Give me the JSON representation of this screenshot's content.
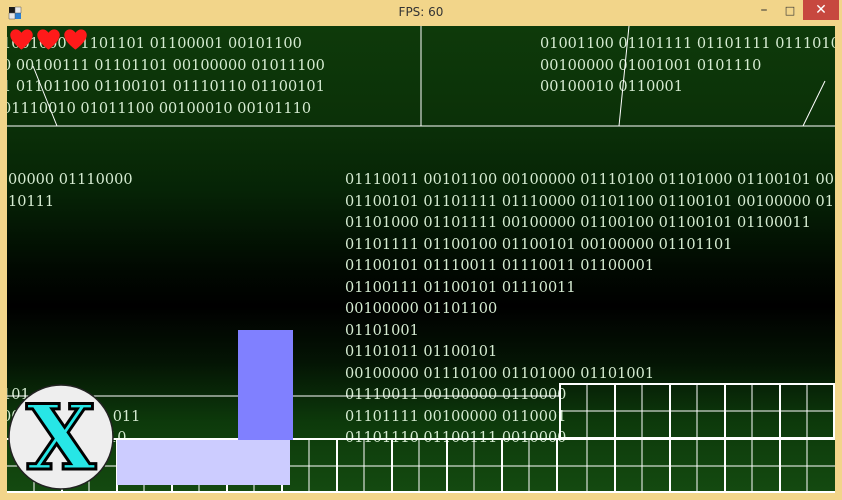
{
  "window": {
    "title": "FPS: 60",
    "controls": {
      "minimize": "–",
      "maximize": "□",
      "close": "✕"
    }
  },
  "hud": {
    "lives": 3,
    "heart_color": "#ff1a1a"
  },
  "logo": {
    "letter": "X",
    "letter_color": "#27e6e6",
    "badge_color": "#eeeeee"
  },
  "binary_text": {
    "top_left": "1001000 01101101 01100001 00101100\n0 00100111 01101101 00100000 01011100\n1 01101100 01100101 01110110 01100101\n01110010 01011100 00100010 00101110",
    "top_right": "01001100 01101111 01101111 01110101\n00100000 01001001 0101110\n00100010 0110001",
    "mid_left": "00000 01110000\n10111",
    "mid_right": "01110011 00101100 00100000 01110100 01101000 01100101 001\n01100101 01101111 01110000 01101100 01100101 00100000 011\n01101000 01101111 00100000 01100100 01100101 01100011\n01101111 01100100 01100101 00100000 01101101\n01100101 01110011 01110011 01100001\n01100111 01100101 01110011\n00100000 01101100\n01101001\n01101011 01100101\n00100000 01110100 01101000 01101001\n01110011 00100000 0110000\n01101111 00100000 0110001\n01101110 01100111 0010000",
    "bottom_left": "101\n000 01101111 011\n  00100000 0110"
  },
  "colors": {
    "player_block": "#8080ff",
    "floor_block": "#ccccff",
    "grid_line": "#ffffff",
    "binary_text": "#d6ecd2"
  }
}
